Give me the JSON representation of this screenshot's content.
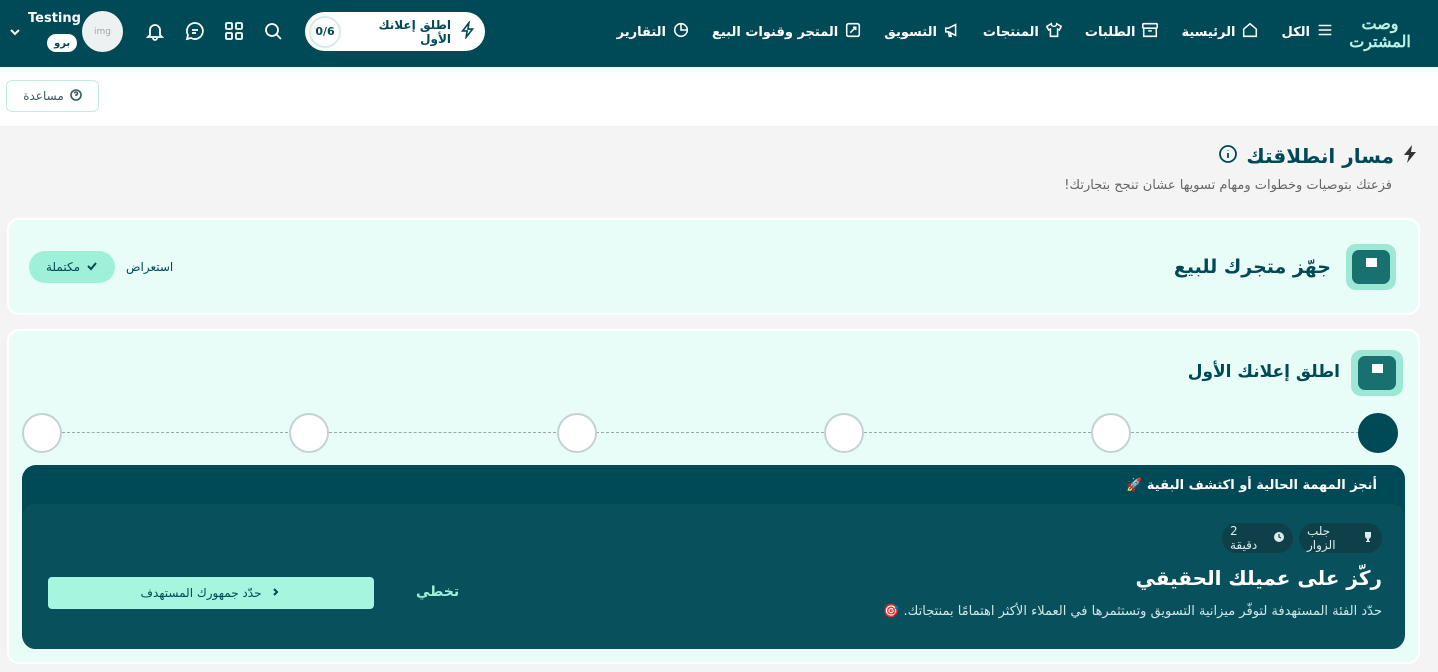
{
  "brand": {
    "logo_line1": "وصت",
    "logo_line2": "المشترت"
  },
  "nav": {
    "items": [
      {
        "label": "الكل",
        "icon": "menu-icon"
      },
      {
        "label": "الرئيسية",
        "icon": "home-icon"
      },
      {
        "label": "الطلبات",
        "icon": "archive-icon"
      },
      {
        "label": "المنتجات",
        "icon": "shirt-icon"
      },
      {
        "label": "التسويق",
        "icon": "megaphone-icon"
      },
      {
        "label": "المتجر وقنوات البيع",
        "icon": "store-icon"
      },
      {
        "label": "التقارير",
        "icon": "pie-chart-icon"
      }
    ]
  },
  "launch_pill": {
    "count": "0/6",
    "label": "اطلق إعلانك الأول",
    "icon": "bolt-icon"
  },
  "toolbar": {
    "icons": [
      "search-icon",
      "apps-grid-icon",
      "chat-icon",
      "bell-icon"
    ]
  },
  "user": {
    "name": "Testing",
    "plan": "برو",
    "avatar_text": "img"
  },
  "help": {
    "label": "مساعدة"
  },
  "page": {
    "title": "مسار انطلاقتك",
    "subtitle": "فزعتك بتوصيات وخطوات ومهام تسويها عشان تنجح بتجارتك!"
  },
  "card1": {
    "title": "جهّز متجرك للبيع",
    "status": "مكتملة",
    "review_label": "استعراض"
  },
  "card2": {
    "title": "اطلق إعلانك الأول",
    "steps_total": 6,
    "active_step": 1
  },
  "task_panel": {
    "header": "أنجز المهمة الحالية أو اكتشف البقية 🚀",
    "tag_visitors": "جلب الزوار",
    "tag_duration": "2 دقيقة",
    "title": "ركّز على عميلك الحقيقي",
    "description": "حدّد الفئة المستهدفة لتوفّر ميزانية التسويق وتستثمرها في العملاء الأكثر اهتمامًا بمنتجاتك. 🎯",
    "skip_label": "تخطي",
    "cta_label": "حدّد جمهورك المستهدف"
  },
  "colors": {
    "primary": "#004956",
    "accent": "#a6f5de",
    "card_bg": "#e8fdf8"
  }
}
